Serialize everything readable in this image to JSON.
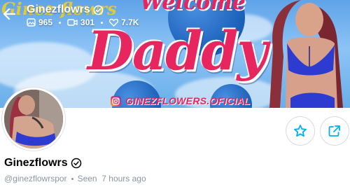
{
  "header": {
    "title": "Ginezflowrs",
    "stats": {
      "photos": "965",
      "videos": "301",
      "likes": "7.7K"
    }
  },
  "cover": {
    "welcome_text": "Welcome",
    "big_text": "Daddy",
    "corner_script": "Ginez flowrs",
    "instagram_handle": "GINEZFLOWERS.OFICIAL"
  },
  "profile": {
    "name": "Ginezflowrs",
    "username": "@ginezflowrspor",
    "last_seen": "Seen  7 hours ago"
  },
  "icons": {
    "back": "arrow-left-icon",
    "verified": "verified-badge-icon",
    "photos": "image-icon",
    "videos": "video-icon",
    "likes": "heart-icon",
    "favorite": "star-icon",
    "share": "share-icon"
  },
  "colors": {
    "accent": "#00aff0",
    "cover_text": "#e7265f",
    "muted": "#8a96a3"
  }
}
